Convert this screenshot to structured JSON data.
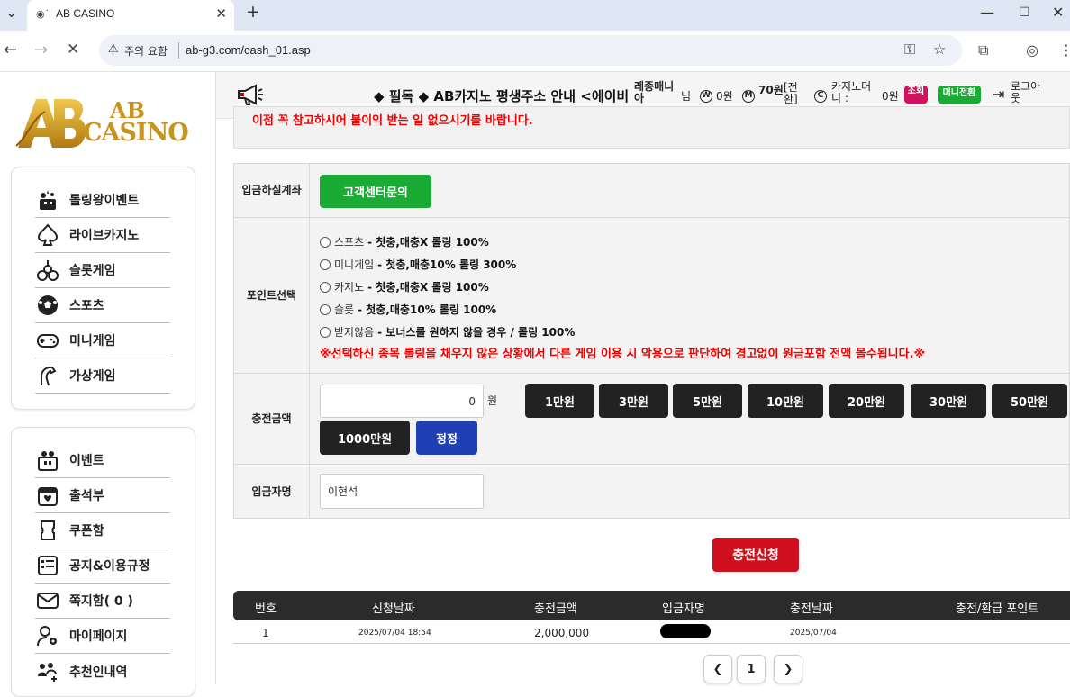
{
  "browser": {
    "tab_title": "AB CASINO",
    "url": "ab-g3.com/cash_01.asp",
    "security_label": "주의 요함"
  },
  "logo": {
    "line1": "AB",
    "line2": "CASINO"
  },
  "sidebar": {
    "menu1": [
      {
        "label": "롤링왕이벤트",
        "icon": "trophy-icon"
      },
      {
        "label": "라이브카지노",
        "icon": "spade-icon"
      },
      {
        "label": "슬롯게임",
        "icon": "cherry-icon"
      },
      {
        "label": "스포츠",
        "icon": "soccer-ball-icon"
      },
      {
        "label": "미니게임",
        "icon": "gamepad-icon"
      },
      {
        "label": "가상게임",
        "icon": "horse-icon"
      }
    ],
    "menu2": [
      {
        "label": "이벤트",
        "icon": "gift-icon"
      },
      {
        "label": "출석부",
        "icon": "calendar-icon"
      },
      {
        "label": "쿠폰함",
        "icon": "coupon-icon"
      },
      {
        "label": "공지&이용규정",
        "icon": "notice-icon"
      },
      {
        "label": "쪽지함( 0 )",
        "icon": "mail-icon"
      },
      {
        "label": "마이페이지",
        "icon": "user-settings-icon"
      },
      {
        "label": "추천인내역",
        "icon": "referral-icon"
      }
    ]
  },
  "topbar": {
    "notice": "◆ 필독 ◆ AB카지노 평생주소 안내 <에이비",
    "username": "레종매니아",
    "honorific": "님",
    "w_money": "0원",
    "m_points": "70원",
    "convert_label": "[전환]",
    "casino_label": "카지노머니 :",
    "casino_money": "0원",
    "inquiry_btn": "조회",
    "transfer_btn": "머니전환",
    "logout": "로그아웃"
  },
  "warning_strip": "이점 꼭 참고하시어 불이익 받는 일 없으시기를 바랍니다.",
  "form": {
    "account_label": "입금하실계좌",
    "support_btn": "고객센터문의",
    "point_label": "포인트선택",
    "point_options": [
      {
        "name": "스포츠",
        "desc": "- 첫충,매충X 롤링 100%"
      },
      {
        "name": "미니게임",
        "desc": "- 첫충,매충10% 롤링 300%"
      },
      {
        "name": "카지노",
        "desc": "- 첫충,매충X 롤링 100%"
      },
      {
        "name": "슬롯",
        "desc": "- 첫충,매충10% 롤링 100%"
      },
      {
        "name": "받지않음",
        "desc": "- 보너스를 원하지 않을 경우 / 롤링 100%"
      }
    ],
    "point_warning": "※선택하신 종목 롤링을 채우지 않은 상황에서 다른 게임 이용 시 악용으로 판단하여 경고없이 원금포함 전액 몰수됩니다.※",
    "amount_label": "충전금액",
    "amount_value": "0",
    "amount_unit": "원",
    "amount_buttons": [
      "1만원",
      "3만원",
      "5만원",
      "10만원",
      "20만원",
      "30만원",
      "50만원",
      "1000만원"
    ],
    "reset_btn": "정정",
    "depositor_label": "입금자명",
    "depositor_value": "이현석"
  },
  "submit_btn": "충전신청",
  "history": {
    "headers": [
      "번호",
      "신청날짜",
      "충전금액",
      "입금자명",
      "충전날짜",
      "충전/환급 포인트"
    ],
    "rows": [
      {
        "no": "1",
        "request_date": "2025/07/04 18:54",
        "amount": "2,000,000",
        "depositor": "",
        "charge_date": "2025/07/04",
        "points": ""
      }
    ]
  },
  "pagination": {
    "current": "1"
  },
  "colors": {
    "accent_green": "#1aab34",
    "accent_red": "#d0101e",
    "accent_blue": "#1f3fb5",
    "dark_button": "#222222",
    "warning_red": "#e00000",
    "logo_gold": "#c8941e"
  }
}
